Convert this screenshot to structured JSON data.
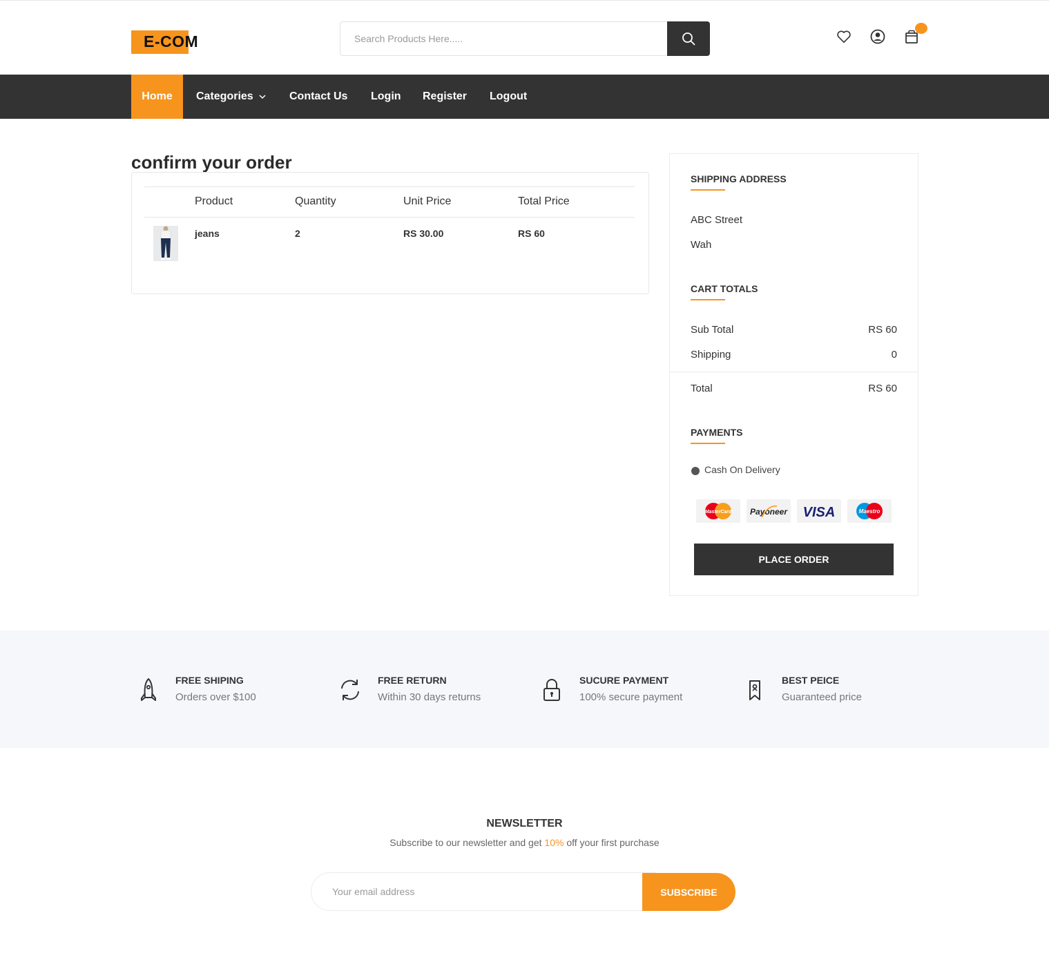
{
  "header": {
    "logo_text": "E-COM",
    "search_placeholder": "Search Products Here.....",
    "icons": [
      "heart-icon",
      "user-icon",
      "cart-icon",
      "search-icon"
    ]
  },
  "nav": {
    "items": [
      "Home",
      "Categories",
      "Contact Us",
      "Login",
      "Register",
      "Logout"
    ]
  },
  "order": {
    "title": "confirm your order",
    "columns": [
      "Product",
      "Quantity",
      "Unit Price",
      "Total Price"
    ],
    "rows": [
      {
        "product": "jeans",
        "quantity": "2",
        "unit_price": "RS 30.00",
        "total_price": "RS 60"
      }
    ]
  },
  "shipping": {
    "title": "SHIPPING ADDRESS",
    "line1": "ABC Street",
    "line2": "Wah"
  },
  "cart_totals": {
    "title": "CART TOTALS",
    "subtotal_label": "Sub Total",
    "subtotal_value": "RS 60",
    "shipping_label": "Shipping",
    "shipping_value": "0",
    "total_label": "Total",
    "total_value": "RS 60"
  },
  "payments": {
    "title": "PAYMENTS",
    "method": "Cash On Delivery",
    "cards": [
      "MasterCard",
      "Payoneer",
      "VISA",
      "Maestro"
    ],
    "place_order": "PLACE ORDER"
  },
  "features": [
    {
      "title": "FREE SHIPING",
      "subtitle": "Orders over $100",
      "icon": "rocket-icon"
    },
    {
      "title": "FREE RETURN",
      "subtitle": "Within 30 days returns",
      "icon": "refresh-icon"
    },
    {
      "title": "SUCURE PAYMENT",
      "subtitle": "100% secure payment",
      "icon": "lock-icon"
    },
    {
      "title": "BEST PEICE",
      "subtitle": "Guaranteed price",
      "icon": "tag-icon"
    }
  ],
  "newsletter": {
    "title": "NEWSLETTER",
    "subtitle_before": "Subscribe to our newsletter and get ",
    "subtitle_highlight": "10%",
    "subtitle_after": " off your first purchase",
    "placeholder": "Your email address",
    "button": "SUBSCRIBE"
  },
  "colors": {
    "accent": "#f7941d",
    "dark": "#333333",
    "feature_bg": "#f6f7fb"
  }
}
